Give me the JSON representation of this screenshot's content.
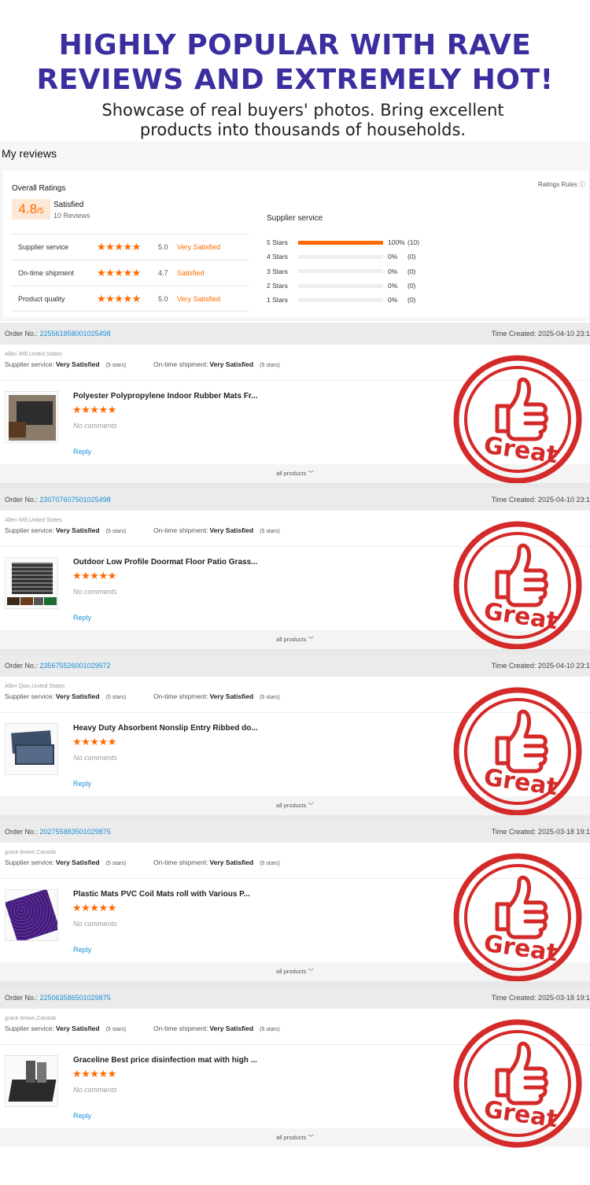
{
  "hero": {
    "headline_line1": "HIGHLY POPULAR WITH RAVE",
    "headline_line2": "REVIEWS AND EXTREMELY HOT!",
    "sub_line1": "Showcase of real buyers' photos. Bring excellent",
    "sub_line2": "products into thousands of households."
  },
  "my_reviews": {
    "title": "My reviews",
    "overall_label": "Overall Ratings",
    "ratings_rules": "Ratings Rules ⓘ",
    "score": "4.8",
    "score_suffix": "/5",
    "satisfied": "Satisfied",
    "review_count": "10 Reviews",
    "criteria": [
      {
        "label": "Supplier service",
        "stars": "★★★★★",
        "score": "5.0",
        "text": "Very Satisfied"
      },
      {
        "label": "On-time shipment",
        "stars": "★★★★★",
        "score": "4.7",
        "text": "Satisfied"
      },
      {
        "label": "Product quality",
        "stars": "★★★★★",
        "score": "5.0",
        "text": "Very Satisfied"
      }
    ],
    "supplier_service_title": "Supplier service",
    "star_breakdown": [
      {
        "label": "5 Stars",
        "percent": "100%",
        "count": "(10)",
        "fill": 1.0
      },
      {
        "label": "4 Stars",
        "percent": "0%",
        "count": "(0)",
        "fill": 0
      },
      {
        "label": "3 Stars",
        "percent": "0%",
        "count": "(0)",
        "fill": 0
      },
      {
        "label": "2 Stars",
        "percent": "0%",
        "count": "(0)",
        "fill": 0
      },
      {
        "label": "1 Stars",
        "percent": "0%",
        "count": "(0)",
        "fill": 0
      }
    ]
  },
  "common": {
    "order_no_label": "Order No.:",
    "supplier_service_label": "Supplier service:",
    "shipment_label": "On-time shipment:",
    "very_satisfied": "Very Satisfied",
    "five_stars": "(5 stars)",
    "stars": "★★★★★",
    "no_comments": "No comments",
    "reply": "Reply",
    "all_products": "all products ﹀",
    "stamp_text": "Great"
  },
  "orders": [
    {
      "order_no": "225561858001025498",
      "time": "Time Created: 2025-04-10 23:1",
      "buyer": "Allen Will,United States",
      "product": "Polyester Polypropylene Indoor Rubber Mats Fr..."
    },
    {
      "order_no": "230707607501025498",
      "time": "Time Created: 2025-04-10 23:1",
      "buyer": "Allen Will,United States",
      "product": "Outdoor Low Profile Doormat Floor Patio Grass..."
    },
    {
      "order_no": "235675526001029572",
      "time": "Time Created: 2025-04-10 23:1",
      "buyer": "Allen Qian,United States",
      "product": "Heavy Duty Absorbent Nonslip Entry Ribbed do..."
    },
    {
      "order_no": "202755883501029875",
      "time": "Time Created: 2025-03-18 19:1",
      "buyer": "grace brown,Canada",
      "product": "Plastic Mats PVC Coil Mats roll with Various P..."
    },
    {
      "order_no": "225063586501029875",
      "time": "Time Created: 2025-03-18 19:1",
      "buyer": "grace brown,Canada",
      "product": "Graceline Best price disinfection mat with high ..."
    }
  ],
  "colors": {
    "accent": "#ff6a00",
    "headline": "#3b2fa0",
    "link": "#1a8fd6",
    "stamp": "#d42a2a"
  }
}
